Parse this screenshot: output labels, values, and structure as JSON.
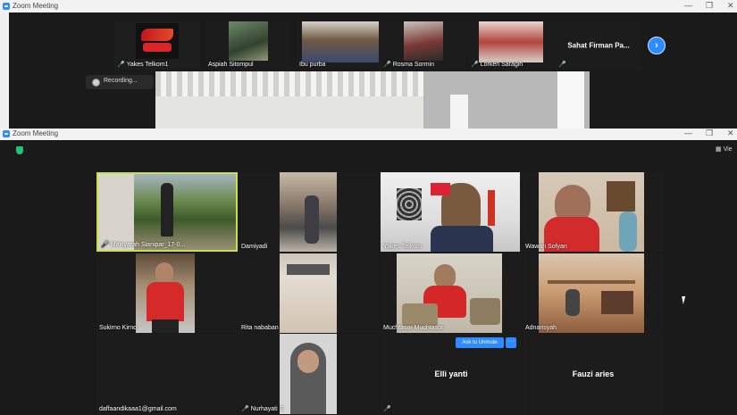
{
  "top_window": {
    "title": "Zoom Meeting",
    "strip": [
      {
        "name": "Yakes Telkom1",
        "muted": true
      },
      {
        "name": "Aspiah Sitompul",
        "muted": false
      },
      {
        "name": "Ibu purba",
        "muted": false
      },
      {
        "name": "Rosma Sormin",
        "muted": true
      },
      {
        "name": "Lorken Saragih",
        "muted": true
      },
      {
        "name": "Sahat Firman Pa...",
        "muted": true
      }
    ],
    "recording_label": "Recording..."
  },
  "main_window": {
    "title": "Zoom Meeting",
    "view_label": "Vie",
    "ask_unmute_label": "Ask to Unmute",
    "more_label": "···",
    "grid": [
      {
        "name": "Maisyarah Sianipar_17-0...",
        "muted": true,
        "active": true
      },
      {
        "name": "Damiyadi",
        "muted": false
      },
      {
        "name": "Yakes Telkom",
        "muted": false
      },
      {
        "name": "Wawan Sofyan",
        "muted": false
      },
      {
        "name": "Sukirno Kirno",
        "muted": false
      },
      {
        "name": "Rita nababan",
        "muted": false
      },
      {
        "name": "Muchtasor Muchtasor",
        "muted": false
      },
      {
        "name": "Adnansyah",
        "muted": false
      },
      {
        "name": "daffaandikaaa1@gmail.com",
        "muted": false
      },
      {
        "name": "Nurhayati S",
        "muted": true
      },
      {
        "name": "Elli yanti",
        "muted": true
      },
      {
        "name": "Fauzi aries",
        "muted": false
      }
    ]
  },
  "colors": {
    "zoom_blue": "#2d8cff",
    "active_border": "#c8e04a",
    "mic_red": "#e03b3b"
  }
}
